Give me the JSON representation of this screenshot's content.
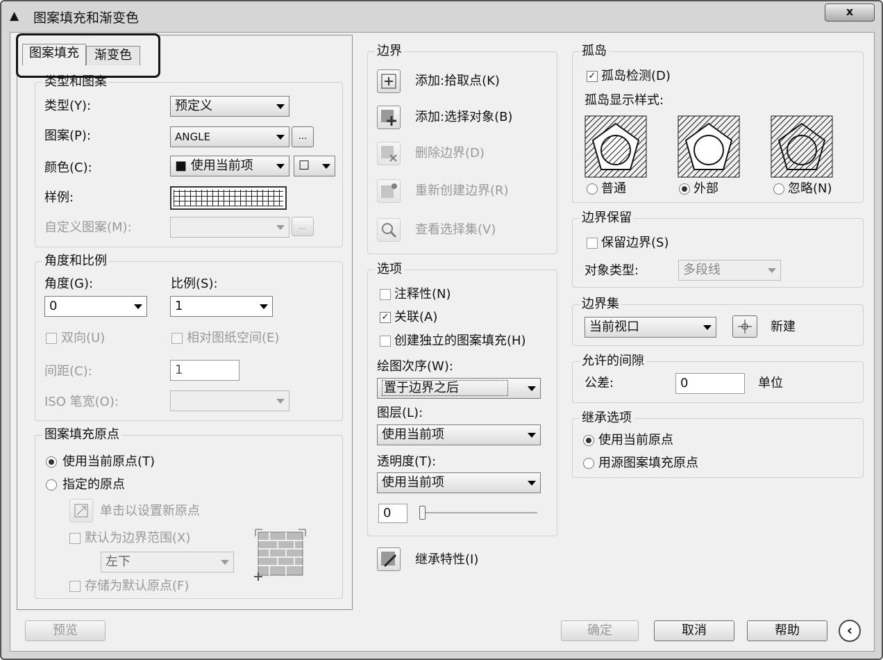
{
  "window": {
    "title": "图案填充和渐变色",
    "close": "x"
  },
  "tabs": [
    "图案填充",
    "渐变色"
  ],
  "type_pattern": {
    "title": "类型和图案",
    "type_label": "类型(Y):",
    "type_value": "预定义",
    "pattern_label": "图案(P):",
    "pattern_value": "ANGLE",
    "color_label": "颜色(C):",
    "color_value": "■ 使用当前项",
    "bg_value": "☐",
    "swatch_label": "样例:",
    "custom_label": "自定义图案(M):",
    "more": "..."
  },
  "angle_scale": {
    "title": "角度和比例",
    "angle_label": "角度(G):",
    "angle_value": "0",
    "scale_label": "比例(S):",
    "scale_value": "1",
    "double_label": "双向(U)",
    "paper_label": "相对图纸空间(E)",
    "spacing_label": "间距(C):",
    "spacing_value": "1",
    "iso_label": "ISO 笔宽(O):"
  },
  "origin": {
    "title": "图案填充原点",
    "use_current": "使用当前原点(T)",
    "specified": "指定的原点",
    "click_set": "单击以设置新原点",
    "default_extent": "默认为边界范围(X)",
    "position_value": "左下",
    "store_default": "存储为默认原点(F)"
  },
  "boundaries": {
    "title": "边界",
    "add_pick": "添加:拾取点(K)",
    "add_select": "添加:选择对象(B)",
    "remove": "删除边界(D)",
    "recreate": "重新创建边界(R)",
    "view": "查看选择集(V)"
  },
  "options": {
    "title": "选项",
    "annotative": "注释性(N)",
    "associative": "关联(A)",
    "separate": "创建独立的图案填充(H)",
    "draw_order_label": "绘图次序(W):",
    "draw_order_value": "置于边界之后",
    "layer_label": "图层(L):",
    "layer_value": "使用当前项",
    "transparency_label": "透明度(T):",
    "transparency_value": "使用当前项",
    "transparency_number": "0",
    "slider_value": 0
  },
  "inherit_btn": "继承特性(I)",
  "islands": {
    "title": "孤岛",
    "detect": "孤岛检测(D)",
    "style_label": "孤岛显示样式:",
    "normal": "普通",
    "outer": "外部",
    "ignore": "忽略(N)"
  },
  "retention": {
    "title": "边界保留",
    "retain": "保留边界(S)",
    "obj_type_label": "对象类型:",
    "obj_type_value": "多段线"
  },
  "boundary_set": {
    "title": "边界集",
    "value": "当前视口",
    "new_label": "新建"
  },
  "gap": {
    "title": "允许的间隙",
    "tolerance_label": "公差:",
    "tolerance_value": "0",
    "unit_label": "单位"
  },
  "inherit_opts": {
    "title": "继承选项",
    "use_current": "使用当前原点",
    "use_source": "用源图案填充原点"
  },
  "footer": {
    "preview": "预览",
    "ok": "确定",
    "cancel": "取消",
    "help": "帮助"
  }
}
